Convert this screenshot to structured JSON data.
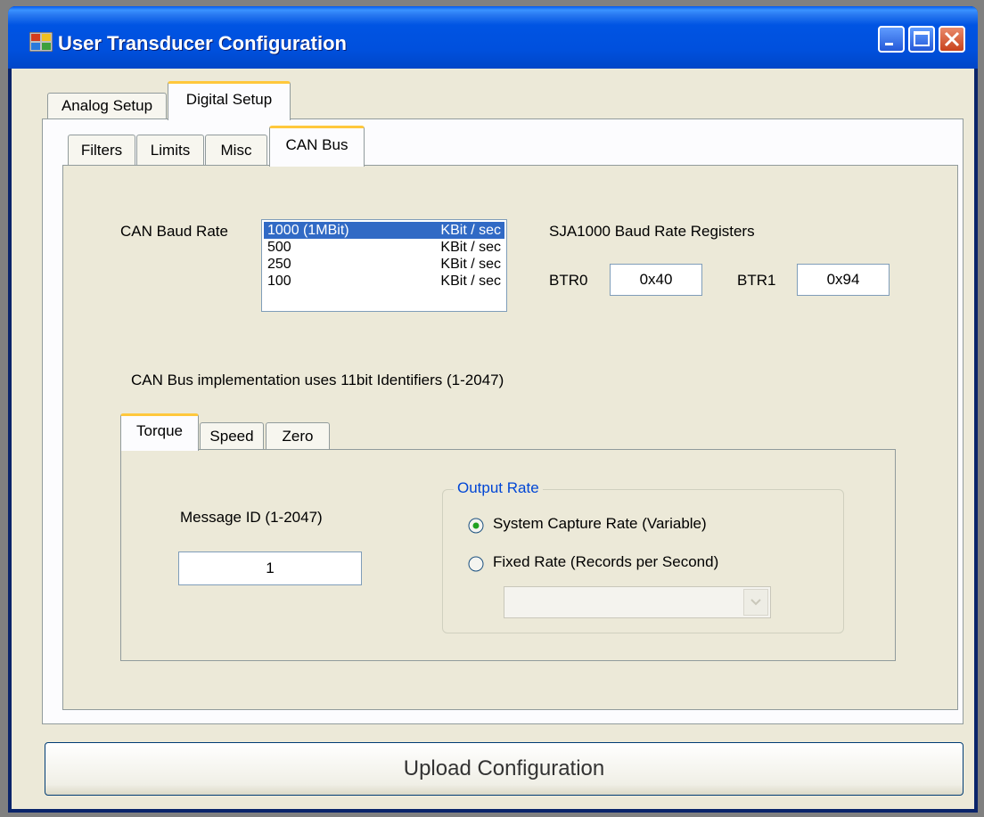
{
  "window": {
    "title": "User Transducer Configuration"
  },
  "main_tabs": [
    "Analog Setup",
    "Digital Setup"
  ],
  "sub_tabs": [
    "Filters",
    "Limits",
    "Misc",
    "CAN Bus"
  ],
  "can": {
    "baud_label": "CAN Baud Rate",
    "baud_options": [
      {
        "value": "1000 (1MBit)",
        "unit": "KBit / sec",
        "selected": true
      },
      {
        "value": "500",
        "unit": "KBit / sec",
        "selected": false
      },
      {
        "value": "250",
        "unit": "KBit / sec",
        "selected": false
      },
      {
        "value": "100",
        "unit": "KBit / sec",
        "selected": false
      }
    ],
    "registers_label": "SJA1000 Baud Rate Registers",
    "btr0_label": "BTR0",
    "btr0_value": "0x40",
    "btr1_label": "BTR1",
    "btr1_value": "0x94",
    "implementation_note": "CAN Bus implementation uses 11bit Identifiers (1-2047)"
  },
  "message_tabs": [
    "Torque",
    "Speed",
    "Zero"
  ],
  "torque": {
    "message_id_label": "Message ID (1-2047)",
    "message_id_value": "1",
    "output_rate_title": "Output Rate",
    "radio_system_label": "System Capture Rate (Variable)",
    "radio_fixed_label": "Fixed Rate (Records per Second)",
    "selected_rate": "system",
    "fixed_rate_value": ""
  },
  "upload_label": "Upload Configuration",
  "colors": {
    "title_bar": "#0054e3",
    "selection": "#316ac5",
    "group_title": "#0046d5",
    "tab_accent": "#ffc83c"
  }
}
